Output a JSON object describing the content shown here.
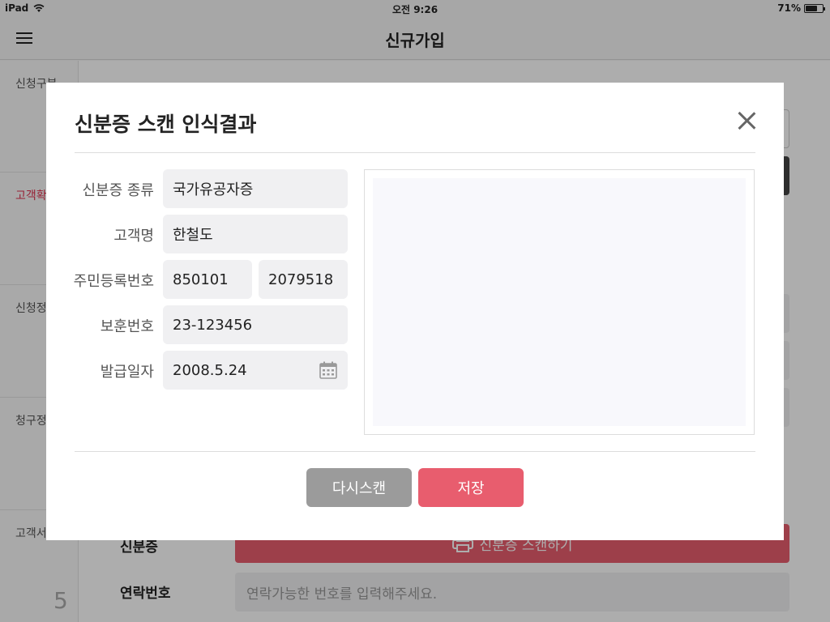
{
  "status": {
    "device": "iPad",
    "time": "오전 9:26",
    "battery": "71%",
    "battery_level": 0.71
  },
  "nav": {
    "title": "신규가입"
  },
  "background": {
    "sidebar": {
      "items": [
        {
          "label": "신청구분"
        },
        {
          "label": "고객확"
        },
        {
          "label": "신청정"
        },
        {
          "label": "청구정"
        },
        {
          "label": "고객서"
        }
      ],
      "step": "5"
    },
    "id_card_label": "신분증",
    "id_scan_button": "신분증 스캔하기",
    "contact_label": "연락번호",
    "contact_placeholder": "연락가능한 번호를 입력해주세요."
  },
  "modal": {
    "title": "신분증 스캔 인식결과",
    "fields": {
      "id_type": {
        "label": "신분증 종류",
        "value": "국가유공자증"
      },
      "name": {
        "label": "고객명",
        "value": "한철도"
      },
      "resident_no": {
        "label": "주민등록번호",
        "value1": "850101",
        "value2": "2079518"
      },
      "veteran_no": {
        "label": "보훈번호",
        "value": "23-123456"
      },
      "issue_date": {
        "label": "발급일자",
        "value": "2008.5.24"
      }
    },
    "buttons": {
      "rescan": "다시스캔",
      "save": "저장"
    }
  }
}
